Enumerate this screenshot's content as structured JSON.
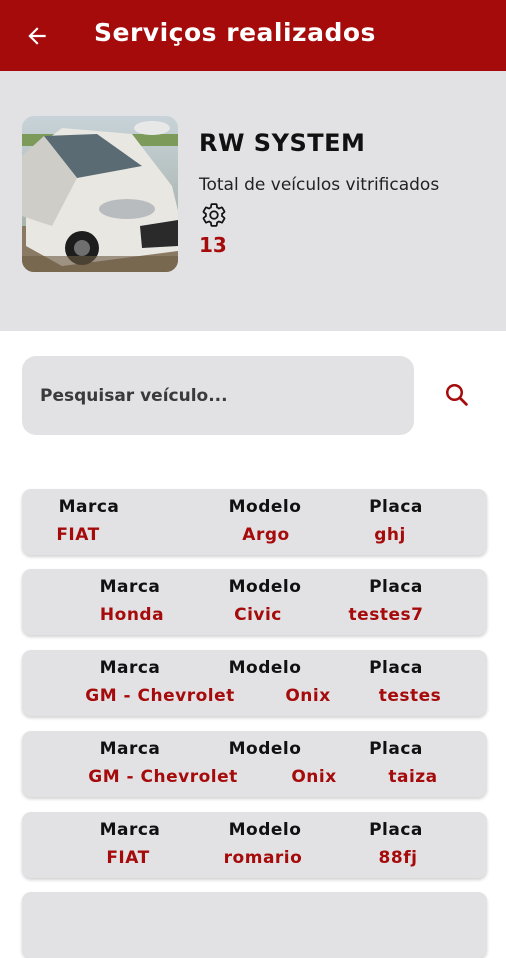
{
  "header": {
    "title": "Serviços realizados",
    "back_icon": "arrow-back-icon"
  },
  "profile": {
    "company": "RW SYSTEM",
    "total_label": "Total de veículos vitrificados",
    "total_icon": "gear-icon",
    "total_count": "13"
  },
  "search": {
    "placeholder": "Pesquisar veículo...",
    "icon": "search-icon"
  },
  "colors": {
    "primary": "#a50b0b",
    "surface": "#e2e2e4"
  },
  "list": {
    "headers": {
      "brand": "Marca",
      "model": "Modelo",
      "plate": "Placa"
    },
    "rows": [
      {
        "brand": "FIAT",
        "model": "Argo",
        "plate": "ghj"
      },
      {
        "brand": "Honda",
        "model": "Civic",
        "plate": "testes7"
      },
      {
        "brand": "GM - Chevrolet",
        "model": "Onix",
        "plate": "testes"
      },
      {
        "brand": "GM - Chevrolet",
        "model": "Onix",
        "plate": "taiza"
      },
      {
        "brand": "FIAT",
        "model": "romario",
        "plate": "88fj"
      }
    ]
  }
}
